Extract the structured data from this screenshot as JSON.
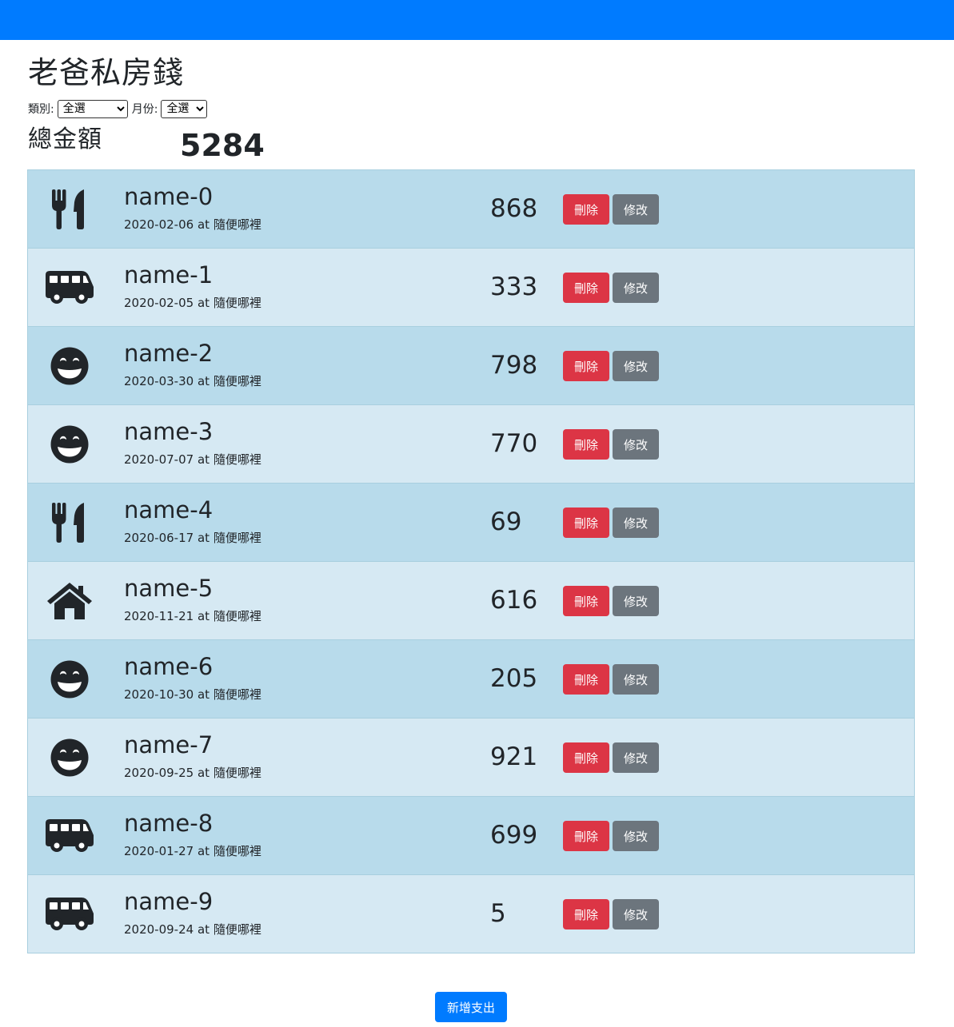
{
  "title": "老爸私房錢",
  "filters": {
    "category_label": "類別:",
    "category_value": "全選",
    "month_label": "月份:",
    "month_value": "全選"
  },
  "total": {
    "label": "總金額",
    "value": "5284"
  },
  "colors": {
    "topbar": "#007bff",
    "row_odd": "#b8dbeb",
    "row_even": "#d6e9f3",
    "delete": "#dc3545",
    "edit": "#6c757d"
  },
  "items": [
    {
      "icon": "utensils-icon",
      "name": "name-0",
      "date": "2020-02-06",
      "at": "at",
      "place": "隨便哪裡",
      "amount": "868",
      "delete_label": "刪除",
      "edit_label": "修改"
    },
    {
      "icon": "bus-icon",
      "name": "name-1",
      "date": "2020-02-05",
      "at": "at",
      "place": "隨便哪裡",
      "amount": "333",
      "delete_label": "刪除",
      "edit_label": "修改"
    },
    {
      "icon": "grin-icon",
      "name": "name-2",
      "date": "2020-03-30",
      "at": "at",
      "place": "隨便哪裡",
      "amount": "798",
      "delete_label": "刪除",
      "edit_label": "修改"
    },
    {
      "icon": "grin-icon",
      "name": "name-3",
      "date": "2020-07-07",
      "at": "at",
      "place": "隨便哪裡",
      "amount": "770",
      "delete_label": "刪除",
      "edit_label": "修改"
    },
    {
      "icon": "utensils-icon",
      "name": "name-4",
      "date": "2020-06-17",
      "at": "at",
      "place": "隨便哪裡",
      "amount": "69",
      "delete_label": "刪除",
      "edit_label": "修改"
    },
    {
      "icon": "home-icon",
      "name": "name-5",
      "date": "2020-11-21",
      "at": "at",
      "place": "隨便哪裡",
      "amount": "616",
      "delete_label": "刪除",
      "edit_label": "修改"
    },
    {
      "icon": "grin-icon",
      "name": "name-6",
      "date": "2020-10-30",
      "at": "at",
      "place": "隨便哪裡",
      "amount": "205",
      "delete_label": "刪除",
      "edit_label": "修改"
    },
    {
      "icon": "grin-icon",
      "name": "name-7",
      "date": "2020-09-25",
      "at": "at",
      "place": "隨便哪裡",
      "amount": "921",
      "delete_label": "刪除",
      "edit_label": "修改"
    },
    {
      "icon": "bus-icon",
      "name": "name-8",
      "date": "2020-01-27",
      "at": "at",
      "place": "隨便哪裡",
      "amount": "699",
      "delete_label": "刪除",
      "edit_label": "修改"
    },
    {
      "icon": "bus-icon",
      "name": "name-9",
      "date": "2020-09-24",
      "at": "at",
      "place": "隨便哪裡",
      "amount": "5",
      "delete_label": "刪除",
      "edit_label": "修改"
    }
  ],
  "add_button": "新增支出"
}
